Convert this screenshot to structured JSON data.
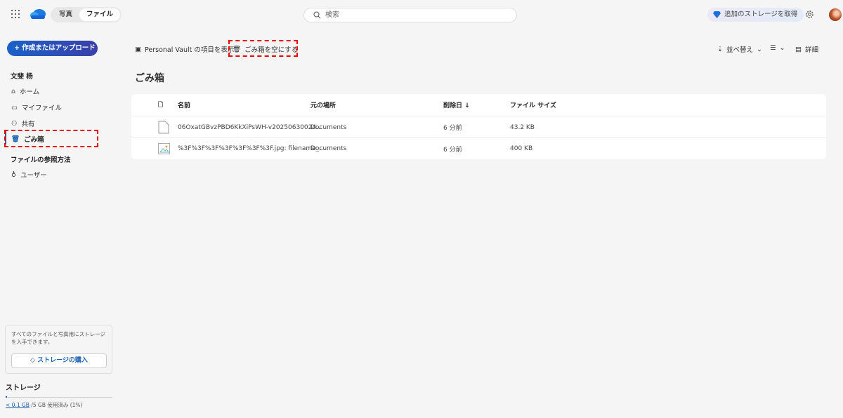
{
  "topbar": {
    "tabs": [
      {
        "label": "写真"
      },
      {
        "label": "ファイル",
        "active": true
      }
    ],
    "search_placeholder": "検索",
    "get_storage": "追加のストレージを取得"
  },
  "sidebar": {
    "create_label": "作成またはアップロード",
    "section1": "文斐 杨",
    "items": [
      {
        "label": "ホーム"
      },
      {
        "label": "マイファイル"
      },
      {
        "label": "共有"
      },
      {
        "label": "ごみ箱",
        "active": true
      }
    ],
    "section2": "ファイルの参照方法",
    "people": "ユーザー",
    "promo_text": "すべてのファイルと写真用にストレージを入手できます。",
    "buy_label": "ストレージの購入",
    "storage_title": "ストレージ",
    "usage_link": "< 0.1 GB",
    "usage_rest": " /5 GB 使用済み (1%)",
    "usage_percent": 1
  },
  "toolbar": {
    "vault": "Personal Vault の項目を表示",
    "empty": "ごみ箱を空にする",
    "sort": "並べ替え",
    "details": "詳細"
  },
  "page_title": "ごみ箱",
  "table": {
    "headers": [
      "名前",
      "元の場所",
      "削除日 ↓",
      "ファイル サイズ"
    ],
    "rows": [
      {
        "name": "06OxatGBvzPBD6KkXiPsWH-v20250630024...",
        "location": "Documents",
        "deleted": "6 分前",
        "size": "43.2 KB",
        "icon": "file-icon"
      },
      {
        "name": "%3F%3F%3F%3F%3F%3F%3F.jpg: filename_...",
        "location": "Documents",
        "deleted": "6 分前",
        "size": "400 KB",
        "icon": "image-icon"
      }
    ]
  },
  "colors": {
    "accent": "#1a5fb4",
    "highlight": "#e00000"
  }
}
